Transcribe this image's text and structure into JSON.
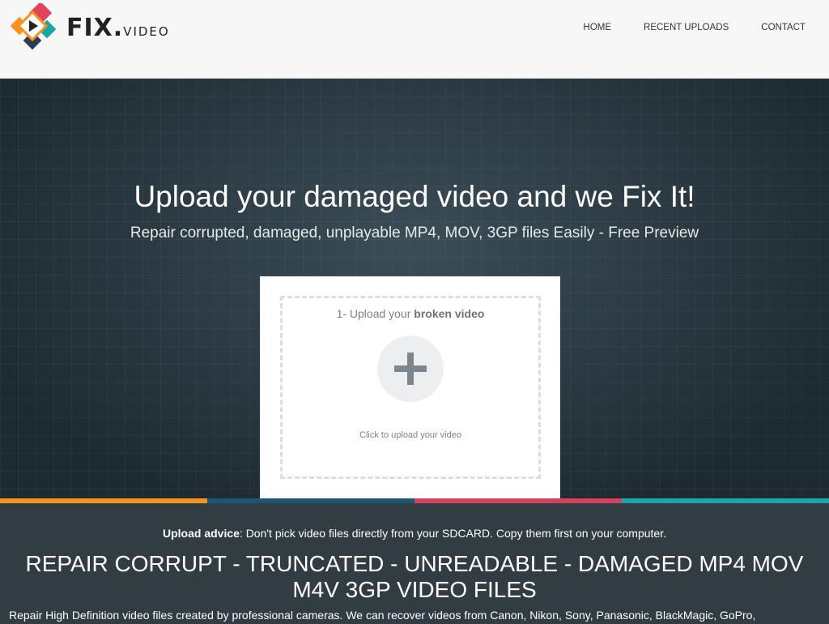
{
  "header": {
    "logo_main": "FIX.",
    "logo_sub": "VIDEO",
    "nav": [
      "HOME",
      "RECENT UPLOADS",
      "CONTACT"
    ]
  },
  "hero": {
    "title": "Upload your damaged video and we Fix It!",
    "subtitle": "Repair corrupted, damaged, unplayable MP4, MOV, 3GP files Easily - Free Preview"
  },
  "upload": {
    "title_prefix": "1- Upload your ",
    "title_bold": "broken video",
    "hint": "Click to upload your video"
  },
  "stripe_colors": [
    "#f7931e",
    "#1b5775",
    "#d6415a",
    "#17a8a6"
  ],
  "advice": {
    "label": "Upload advice",
    "text": ": Don't pick video files directly from your SDCARD. Copy them first on your computer."
  },
  "headline": "REPAIR CORRUPT - TRUNCATED - UNREADABLE - DAMAGED MP4 MOV M4V 3GP VIDEO FILES",
  "description": "Repair High Definition video files created by professional cameras. We can recover videos from Canon, Nikon, Sony, Panasonic, BlackMagic, GoPro,"
}
